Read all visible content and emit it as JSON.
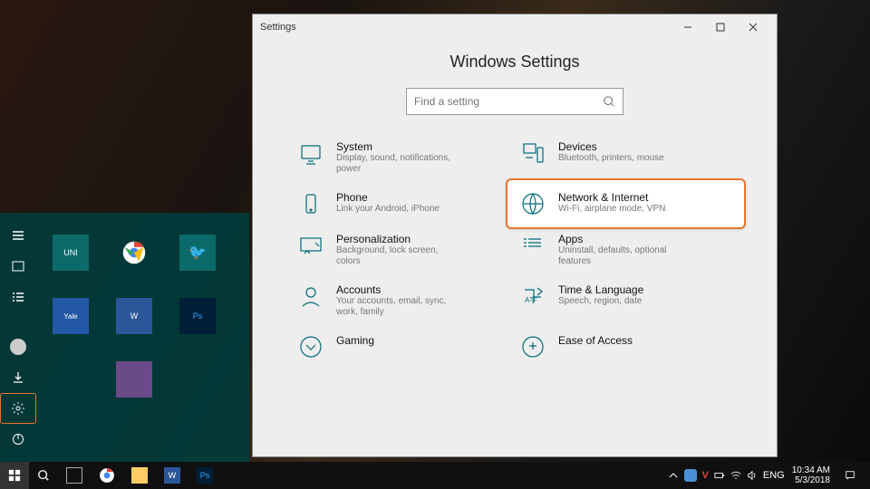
{
  "window": {
    "title": "Settings",
    "heading": "Windows Settings",
    "search_placeholder": "Find a setting"
  },
  "categories": [
    {
      "key": "system",
      "title": "System",
      "desc": "Display, sound, notifications, power"
    },
    {
      "key": "devices",
      "title": "Devices",
      "desc": "Bluetooth, printers, mouse"
    },
    {
      "key": "phone",
      "title": "Phone",
      "desc": "Link your Android, iPhone"
    },
    {
      "key": "network",
      "title": "Network & Internet",
      "desc": "Wi-Fi, airplane mode, VPN",
      "highlighted": true
    },
    {
      "key": "personalization",
      "title": "Personalization",
      "desc": "Background, lock screen, colors"
    },
    {
      "key": "apps",
      "title": "Apps",
      "desc": "Uninstall, defaults, optional features"
    },
    {
      "key": "accounts",
      "title": "Accounts",
      "desc": "Your accounts, email, sync, work, family"
    },
    {
      "key": "time",
      "title": "Time & Language",
      "desc": "Speech, region, date"
    },
    {
      "key": "gaming",
      "title": "Gaming",
      "desc": ""
    },
    {
      "key": "ease",
      "title": "Ease of Access",
      "desc": ""
    }
  ],
  "startmenu": {
    "tiles": [
      {
        "name": "uni",
        "label": "UNI",
        "bg": "#0b6b6b"
      },
      {
        "name": "chrome",
        "label": "",
        "bg": "transparent"
      },
      {
        "name": "bird",
        "label": "",
        "bg": "#0b6b6b"
      },
      {
        "name": "yale",
        "label": "",
        "bg": "#0b6b6b"
      },
      {
        "name": "word",
        "label": "W",
        "bg": "#2b579a"
      },
      {
        "name": "ps",
        "label": "Ps",
        "bg": "#001e36"
      },
      {
        "name": "misc",
        "label": "",
        "bg": "#0b6b6b"
      }
    ],
    "highlighted_rail": "settings"
  },
  "taskbar_apps": [
    {
      "name": "taskview",
      "color": "#888"
    },
    {
      "name": "chrome"
    },
    {
      "name": "explorer",
      "color": "#ffcc66"
    },
    {
      "name": "word",
      "color": "#2b579a",
      "label": "W"
    },
    {
      "name": "ps",
      "color": "#001e36",
      "label": "Ps"
    }
  ],
  "systray": {
    "lang": "ENG",
    "time": "10:34 AM",
    "date": "5/3/2018"
  }
}
